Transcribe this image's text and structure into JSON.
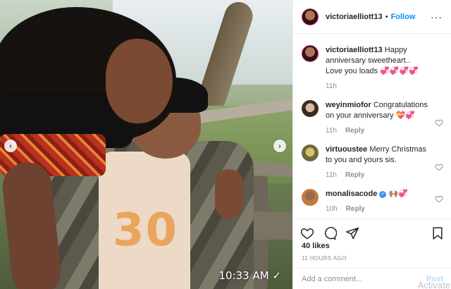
{
  "photo": {
    "timestamp": "10:33 AM ✓",
    "shirt_print": "30"
  },
  "header": {
    "username": "victoriaelliott13",
    "separator": "•",
    "follow_label": "Follow",
    "more_label": "···"
  },
  "comments": [
    {
      "username": "victoriaelliott13",
      "text": "Happy anniversary sweetheart..\nLove you loads",
      "emoji": "💞💞💞💞",
      "age": "11h",
      "reply": ""
    },
    {
      "username": "weyinmiofor",
      "text": "Congratulations on your anniversary ",
      "emoji": "💝💞",
      "age": "11h",
      "reply": "Reply"
    },
    {
      "username": "virtuoustee",
      "text": "Merry Christmas to you and yours sis.",
      "emoji": "",
      "age": "11h",
      "reply": "Reply"
    },
    {
      "username": "monalisacode",
      "text": "",
      "emoji": "🙌🏽💞",
      "age": "10h",
      "reply": "Reply"
    }
  ],
  "likes": "40 likes",
  "posted_ago": "11 HOURS AGO",
  "add_comment": {
    "placeholder": "Add a comment...",
    "post_label": "Post"
  },
  "watermark": "Activate",
  "colors": {
    "follow_blue": "#0095f6",
    "verified_blue": "#3897f0",
    "post_disabled": "#b3dbff",
    "meta_gray": "#8e8e8e"
  }
}
